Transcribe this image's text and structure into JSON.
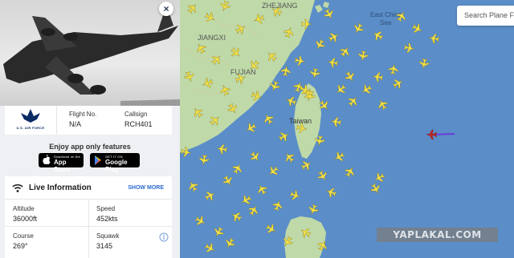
{
  "flight": {
    "close_label": "×",
    "operator_logo_text": "U.S. AIR FORCE",
    "flight_no_label": "Flight No.",
    "flight_no_value": "N/A",
    "callsign_label": "Callsign",
    "callsign_value": "RCH401"
  },
  "promo": {
    "text": "Enjoy app only features",
    "app_store_small": "Download on the",
    "app_store_big": "App Store",
    "google_play_small": "GET IT ON",
    "google_play_big": "Google Play"
  },
  "live": {
    "title": "Live Information",
    "show_more": "SHOW MORE",
    "altitude_label": "Altitude",
    "altitude_value": "36000ft",
    "speed_label": "Speed",
    "speed_value": "452kts",
    "course_label": "Course",
    "course_value": "269°",
    "squawk_label": "Squawk",
    "squawk_value": "3145"
  },
  "map": {
    "labels": {
      "zhejiang": "ZHEJIANG",
      "jiangxi": "JIANGXI",
      "fujian": "FUJIAN",
      "taiwan": "Taiwan",
      "east_china_sea_1": "East China",
      "east_china_sea_2": "Sea"
    },
    "search_placeholder": "Search Plane F",
    "watermark": "YAPLAKAL.COM",
    "colors": {
      "sea": "#5b8ec8",
      "land": "#bfd9a8",
      "aircraft": "#f3e14a",
      "selected_aircraft": "#c02626",
      "track": "#6a3bd6"
    }
  }
}
